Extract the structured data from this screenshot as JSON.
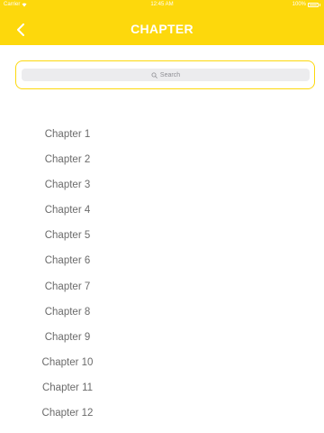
{
  "status_bar": {
    "carrier": "Carrier",
    "time": "12:45 AM",
    "battery": "100%"
  },
  "header": {
    "title": "CHAPTER",
    "back_icon": "chevron-left-icon"
  },
  "search": {
    "placeholder": "Search"
  },
  "chapters": [
    "Chapter 1",
    "Chapter 2",
    "Chapter 3",
    "Chapter 4",
    "Chapter 5",
    "Chapter 6",
    "Chapter 7",
    "Chapter 8",
    "Chapter 9",
    "Chapter 10",
    "Chapter 11",
    "Chapter 12"
  ],
  "colors": {
    "accent": "#FDD80C",
    "search_bg": "#ECECEE",
    "chapter_text": "#6B6B6B"
  }
}
